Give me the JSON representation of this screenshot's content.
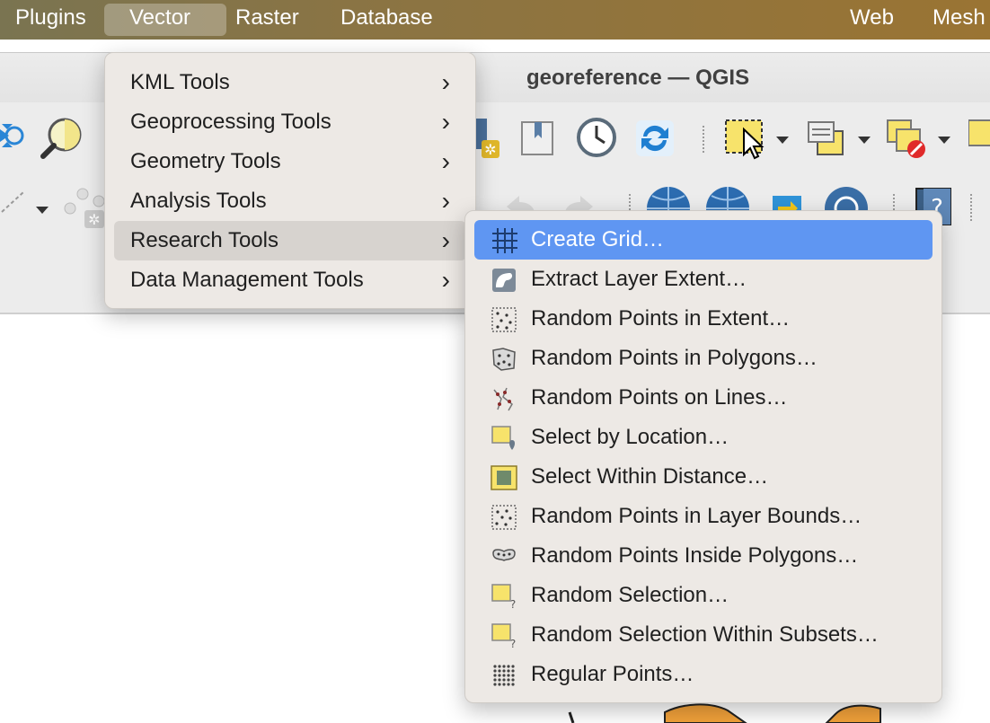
{
  "menubar": {
    "items": [
      "Plugins",
      "Vector",
      "Raster",
      "Database",
      "Web",
      "Mesh"
    ],
    "active": "Vector"
  },
  "window": {
    "title": "georeference — QGIS"
  },
  "vector_menu": {
    "items": [
      {
        "label": "KML Tools",
        "has_submenu": true
      },
      {
        "label": "Geoprocessing Tools",
        "has_submenu": true
      },
      {
        "label": "Geometry Tools",
        "has_submenu": true
      },
      {
        "label": "Analysis Tools",
        "has_submenu": true
      },
      {
        "label": "Research Tools",
        "has_submenu": true,
        "highlighted": true
      },
      {
        "label": "Data Management Tools",
        "has_submenu": true
      }
    ],
    "chevron": "›"
  },
  "research_menu": {
    "items": [
      {
        "label": "Create Grid…",
        "icon": "grid-icon",
        "selected": true
      },
      {
        "label": "Extract Layer Extent…",
        "icon": "layer-extent-icon"
      },
      {
        "label": "Random Points in Extent…",
        "icon": "random-points-extent-icon"
      },
      {
        "label": "Random Points in Polygons…",
        "icon": "random-points-polygons-icon"
      },
      {
        "label": "Random Points on Lines…",
        "icon": "random-points-lines-icon"
      },
      {
        "label": "Select by Location…",
        "icon": "select-location-icon"
      },
      {
        "label": "Select Within Distance…",
        "icon": "select-distance-icon"
      },
      {
        "label": "Random Points in Layer Bounds…",
        "icon": "random-points-bounds-icon"
      },
      {
        "label": "Random Points Inside Polygons…",
        "icon": "random-points-inside-icon"
      },
      {
        "label": "Random Selection…",
        "icon": "random-selection-icon"
      },
      {
        "label": "Random Selection Within Subsets…",
        "icon": "random-selection-subsets-icon"
      },
      {
        "label": "Regular Points…",
        "icon": "regular-points-icon"
      }
    ]
  },
  "colors": {
    "selection_blue": "#5f96f2",
    "menu_bg": "#ede9e5",
    "feature_yellow": "#f7e36b",
    "menubar_gold": "#9a7433"
  }
}
